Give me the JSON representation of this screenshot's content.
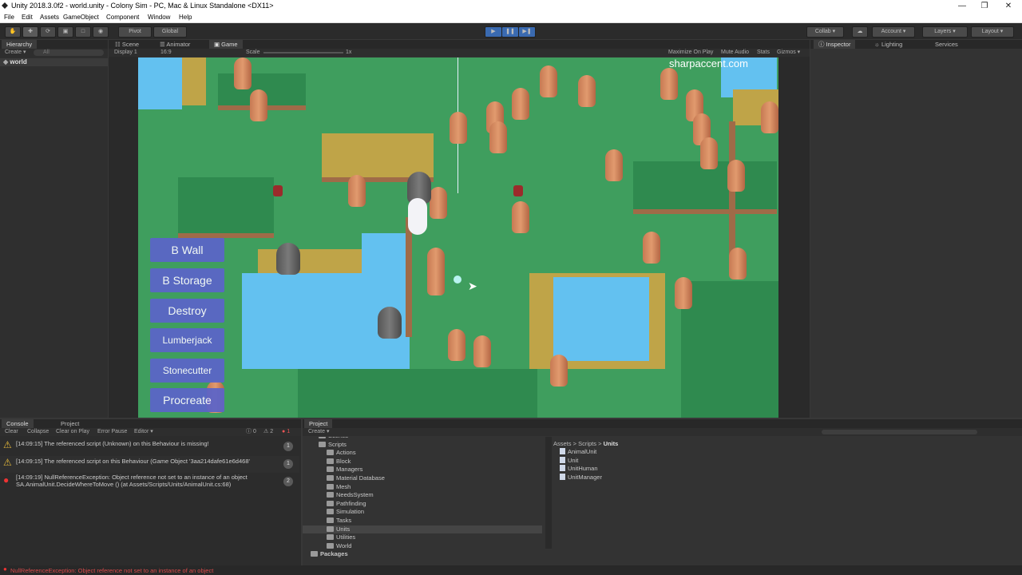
{
  "window": {
    "title": "Unity 2018.3.0f2 - world.unity - Colony Sim - PC, Mac & Linux Standalone <DX11>"
  },
  "menu": [
    "File",
    "Edit",
    "Assets",
    "GameObject",
    "Component",
    "Window",
    "Help"
  ],
  "toolbar": {
    "pivot": "Pivot",
    "global": "Global",
    "collab": "Collab ▾",
    "account": "Account ▾",
    "layers": "Layers ▾",
    "layout": "Layout ▾"
  },
  "hierarchy": {
    "tab": "Hierarchy",
    "create": "Create ▾",
    "search_placeholder": "All",
    "root": "world"
  },
  "scene_tabs": {
    "scene": "Scene",
    "animator": "Animator",
    "game": "Game"
  },
  "game_toolbar": {
    "display": "Display 1",
    "aspect": "16:9",
    "scale_label": "Scale",
    "scale_value": "1x",
    "maximize": "Maximize On Play",
    "mute": "Mute Audio",
    "stats": "Stats",
    "gizmos": "Gizmos ▾"
  },
  "watermark": "sharpaccent.com",
  "game_buttons": [
    "B Wall",
    "B Storage",
    "Destroy",
    "Lumberjack",
    "Stonecutter",
    "Procreate"
  ],
  "inspector": {
    "tab": "Inspector",
    "lighting": "Lighting",
    "services": "Services"
  },
  "console": {
    "tab": "Console",
    "project_tab": "Project",
    "toolbar": [
      "Clear",
      "Collapse",
      "Clear on Play",
      "Error Pause",
      "Editor ▾"
    ],
    "counts": {
      "info": "0",
      "warn": "2",
      "error": "1"
    },
    "entries": [
      {
        "type": "warning",
        "text": "[14:09:15] The referenced script (Unknown) on this Behaviour is missing!",
        "line2": "",
        "count": "1"
      },
      {
        "type": "warning",
        "text": "[14:09:15] The referenced script on this Behaviour (Game Object '3aa214dafe61e6d468'",
        "line2": "",
        "count": "1"
      },
      {
        "type": "error",
        "text": "[14:09:19] NullReferenceException: Object reference not set to an instance of an object",
        "line2": "SA.AnimalUnit.DecideWhereToMove () (at Assets/Scripts/Units/AnimalUnit.cs:68)",
        "count": "2"
      }
    ]
  },
  "project": {
    "tab": "Project",
    "create": "Create ▾",
    "tree": [
      {
        "label": "Scenes",
        "indent": 1
      },
      {
        "label": "Scripts",
        "indent": 1
      },
      {
        "label": "Actions",
        "indent": 2
      },
      {
        "label": "Block",
        "indent": 2
      },
      {
        "label": "Managers",
        "indent": 2
      },
      {
        "label": "Material Database",
        "indent": 2
      },
      {
        "label": "Mesh",
        "indent": 2
      },
      {
        "label": "NeedsSystem",
        "indent": 2
      },
      {
        "label": "Pathfinding",
        "indent": 2
      },
      {
        "label": "Simulation",
        "indent": 2
      },
      {
        "label": "Tasks",
        "indent": 2
      },
      {
        "label": "Units",
        "indent": 2
      },
      {
        "label": "Utilities",
        "indent": 2
      },
      {
        "label": "World",
        "indent": 2
      },
      {
        "label": "Packages",
        "indent": 0
      }
    ],
    "breadcrumb": [
      "Assets",
      "Scripts",
      "Units"
    ],
    "files": [
      "AnimalUnit",
      "Unit",
      "UnitHuman",
      "UnitManager"
    ]
  },
  "status": {
    "error": "NullReferenceException: Object reference not set to an instance of an object"
  },
  "colors": {
    "button": "#5b64c9",
    "grass": "#3f9e5e",
    "water": "#63c1f0",
    "sand": "#bfa448",
    "error": "#d33"
  }
}
